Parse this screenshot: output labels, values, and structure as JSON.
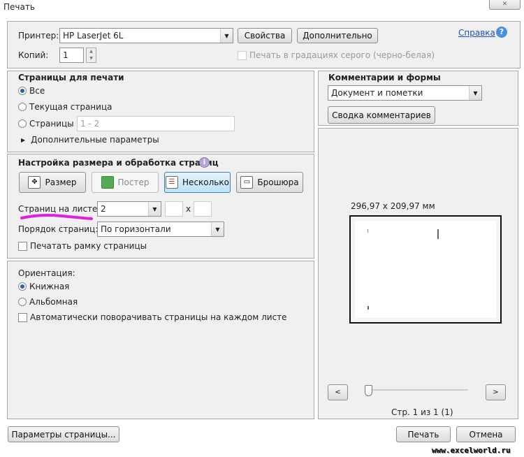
{
  "window": {
    "title": "Печать",
    "close": "✕"
  },
  "top": {
    "printer_label": "Принтер:",
    "printer_value": "HP LaserJet 6L",
    "properties": "Свойства",
    "advanced": "Дополнительно",
    "help": "Справка",
    "copies_label": "Копий:",
    "copies_value": "1",
    "grayscale": "Печать в градациях серого (черно-белая)"
  },
  "pages": {
    "title": "Страницы для печати",
    "all": "Все",
    "current": "Текущая страница",
    "range": "Страницы",
    "range_value": "1 - 2",
    "more": "Дополнительные параметры"
  },
  "sizing": {
    "title": "Настройка размера и обработка страниц",
    "size": "Размер",
    "poster": "Постер",
    "multiple": "Несколько",
    "booklet": "Брошюра",
    "per_sheet_label": "Страниц на листе:",
    "per_sheet_value": "2",
    "x": "x",
    "order_label": "Порядок страниц:",
    "order_value": "По горизонтали",
    "border": "Печатать рамку страницы",
    "highlight_color": "#e020e0"
  },
  "orientation": {
    "title": "Ориентация:",
    "portrait": "Книжная",
    "landscape": "Альбомная",
    "auto_rotate": "Автоматически поворачивать страницы на каждом листе"
  },
  "comments": {
    "title": "Комментарии и формы",
    "value": "Документ и пометки",
    "summary": "Сводка комментариев"
  },
  "preview": {
    "size": "296,97 x 209,97 мм",
    "prev": "<",
    "next": ">",
    "page_info": "Стр. 1 из 1 (1)"
  },
  "bottom": {
    "page_setup": "Параметры страницы...",
    "print": "Печать",
    "cancel": "Отмена"
  },
  "watermark": "www.excelworld.ru"
}
